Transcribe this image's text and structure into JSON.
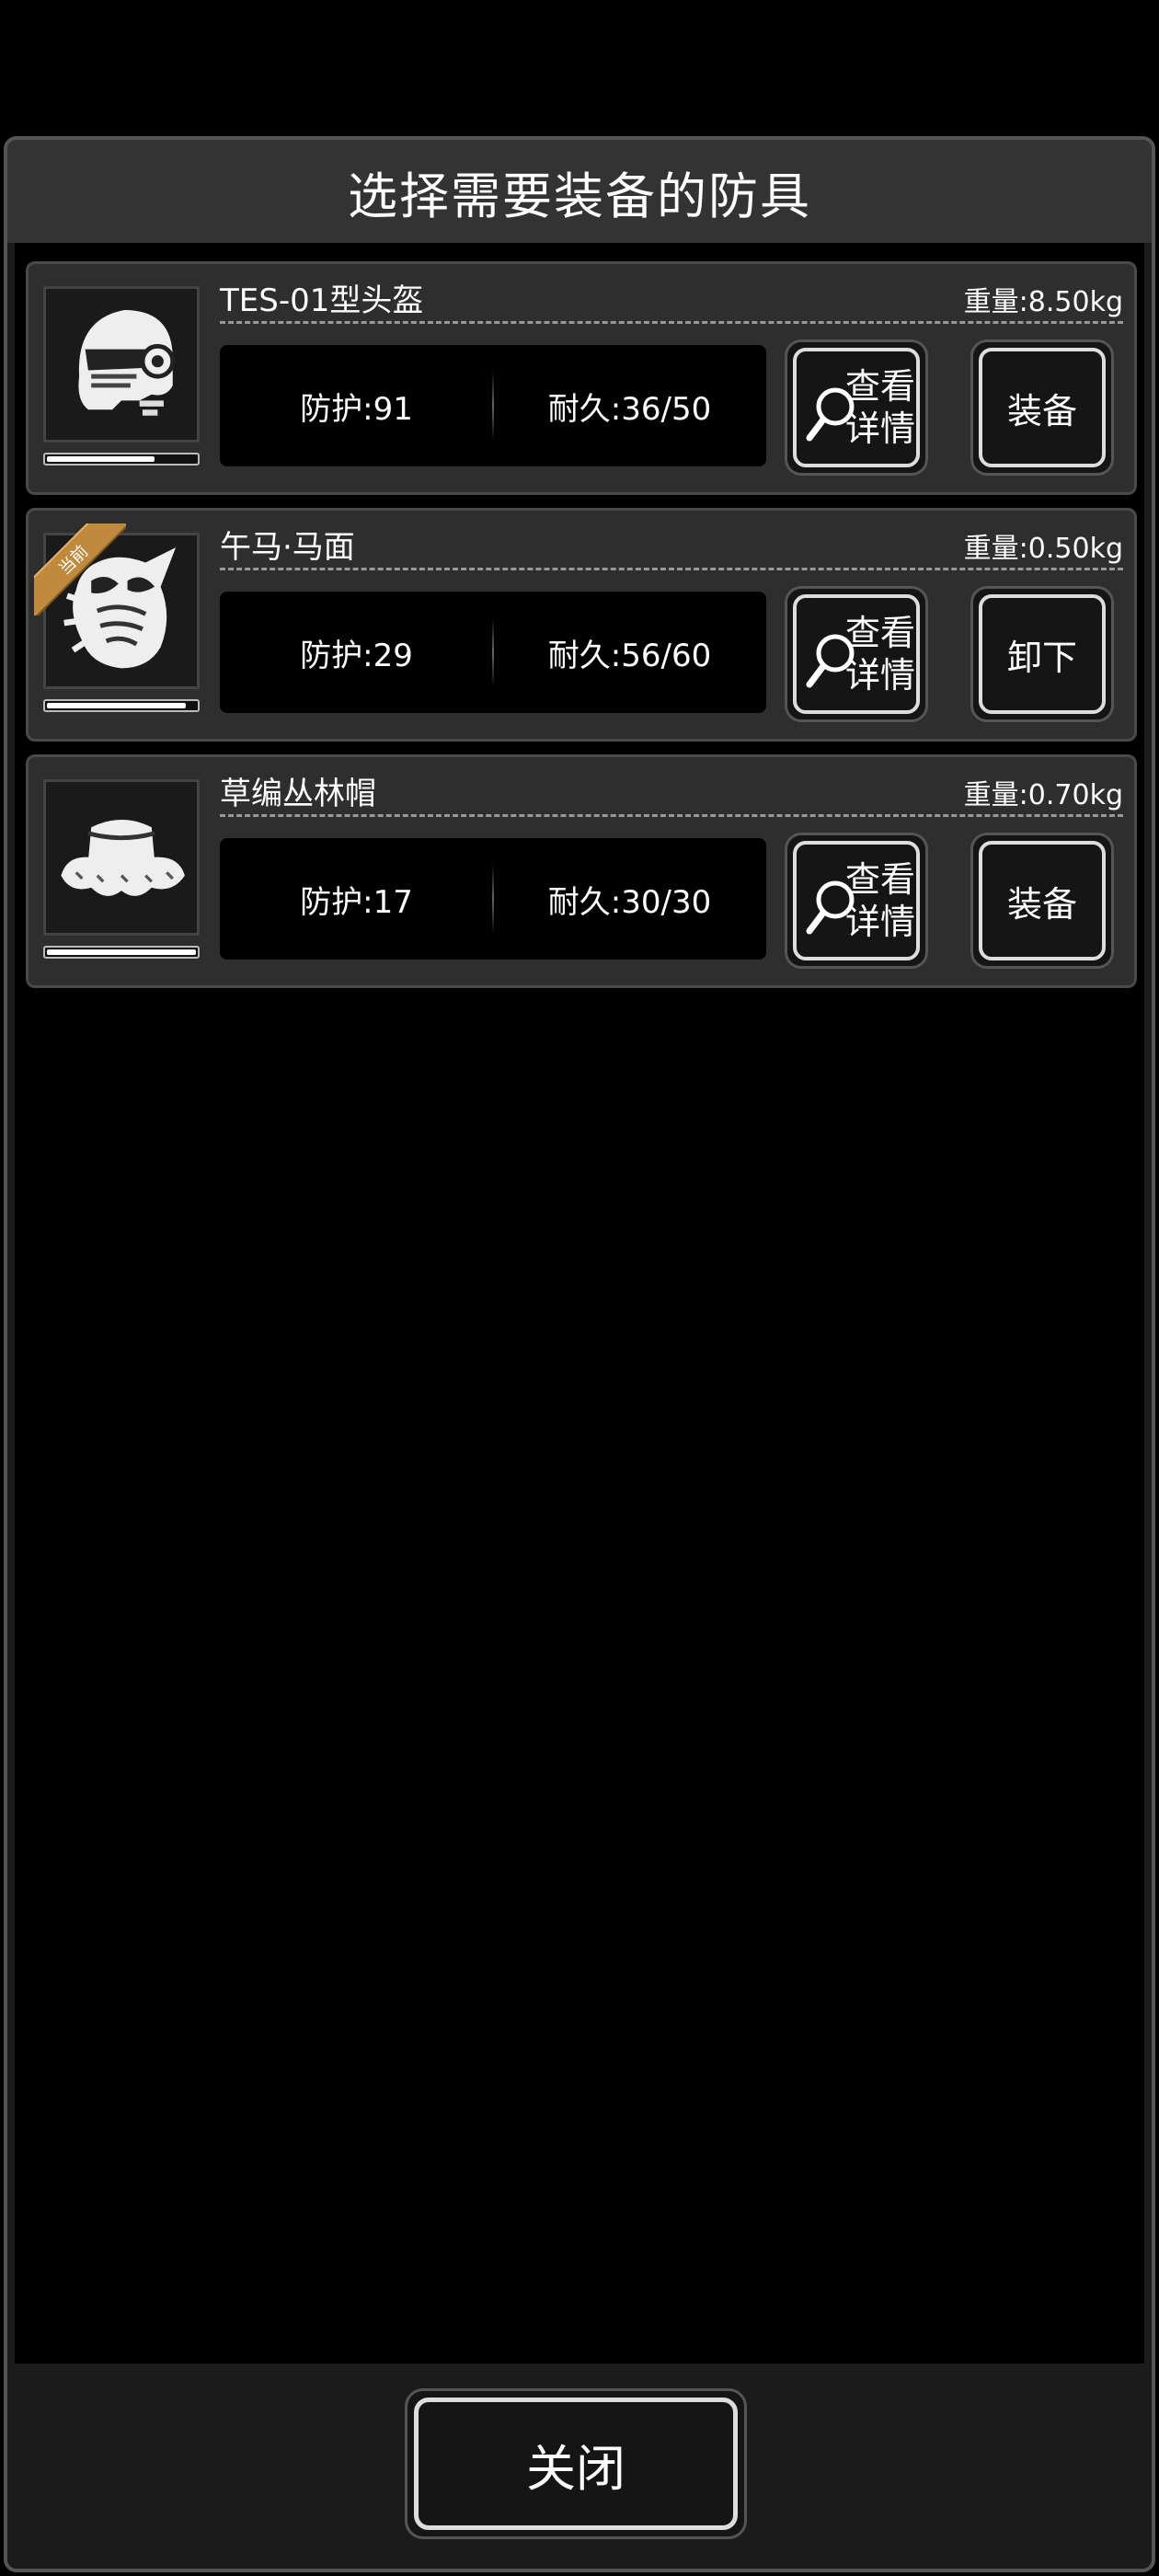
{
  "dialog": {
    "title": "选择需要装备的防具",
    "close_label": "关闭"
  },
  "items": [
    {
      "name": "TES-01型头盔",
      "weight": "重量:8.50kg",
      "protection": "防护:91",
      "durability_text": "耐久:36/50",
      "durability_fraction": 0.72,
      "detail_label": "查看详情",
      "action_label": "装备",
      "icon": "tactical-helmet-icon",
      "current": false
    },
    {
      "name": "午马·马面",
      "weight": "重量:0.50kg",
      "protection": "防护:29",
      "durability_text": "耐久:56/60",
      "durability_fraction": 0.93,
      "detail_label": "查看详情",
      "action_label": "卸下",
      "icon": "horse-mask-icon",
      "current": true,
      "badge_label": "当前"
    },
    {
      "name": "草编丛林帽",
      "weight": "重量:0.70kg",
      "protection": "防护:17",
      "durability_text": "耐久:30/30",
      "durability_fraction": 1.0,
      "detail_label": "查看详情",
      "action_label": "装备",
      "icon": "straw-hat-icon",
      "current": false
    }
  ],
  "colors": {
    "badge": "#c08a3e",
    "panel": "#1b1b1b",
    "card": "#2e2e2e"
  }
}
